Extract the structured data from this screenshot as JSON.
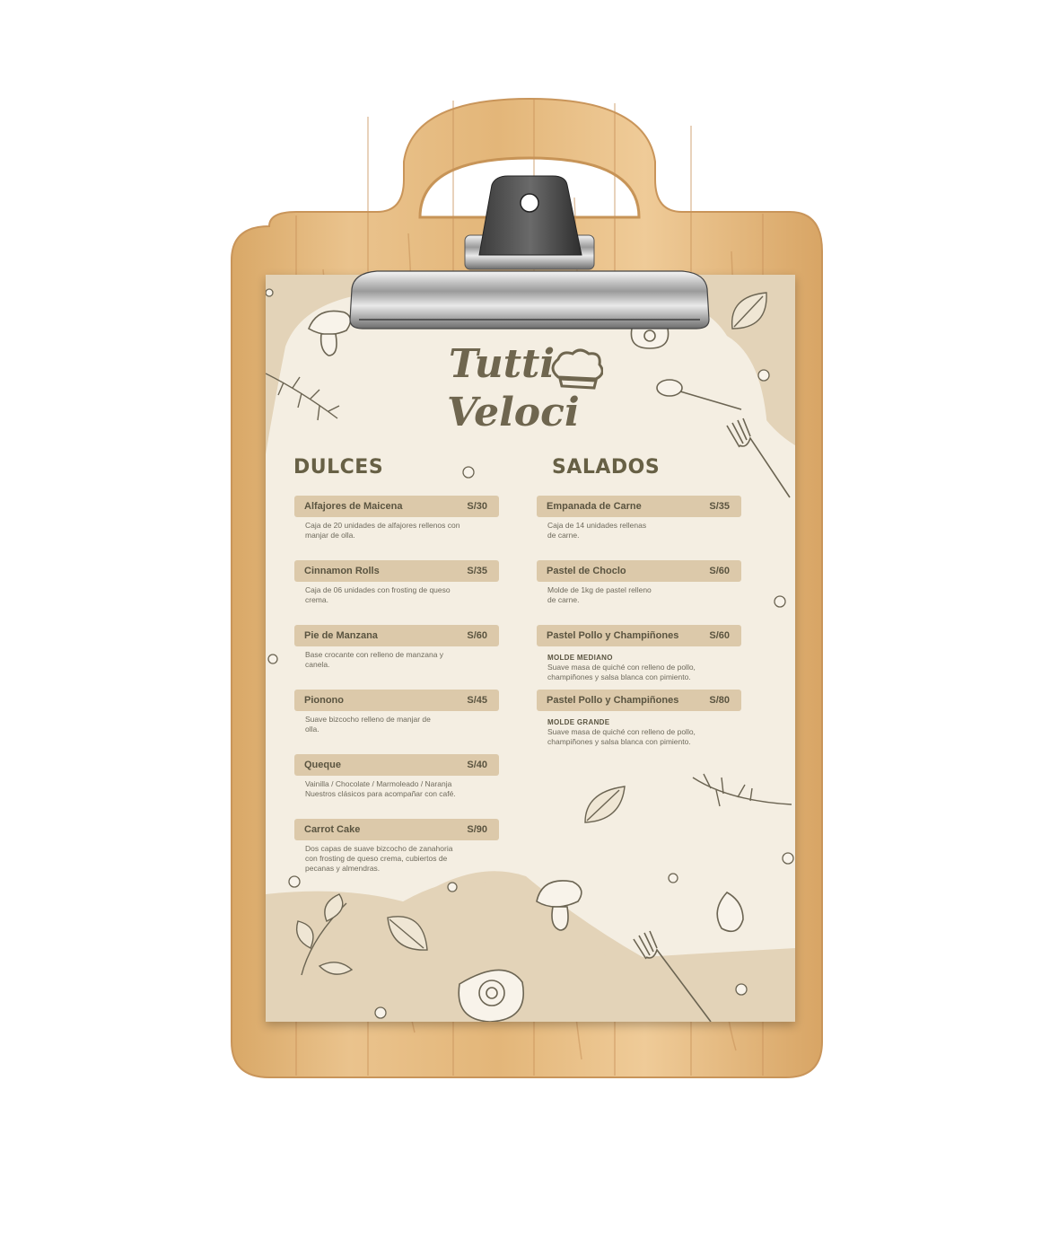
{
  "brand": {
    "line1": "Tutti",
    "line2": "Veloci"
  },
  "dulces": {
    "title": "DULCES",
    "items": [
      {
        "name": "Alfajores de Maicena",
        "price": "S/30",
        "desc": "Caja de 20 unidades de alfajores rellenos con\nmanjar de olla."
      },
      {
        "name": "Cinnamon Rolls",
        "price": "S/35",
        "desc": "Caja de 06 unidades con frosting de queso\ncrema."
      },
      {
        "name": "Pie de Manzana",
        "price": "S/60",
        "desc": "Base crocante con relleno de manzana y\ncanela."
      },
      {
        "name": "Pionono",
        "price": "S/45",
        "desc": "Suave bizcocho relleno de manjar de\nolla."
      },
      {
        "name": "Queque",
        "price": "S/40",
        "desc": "Vainilla / Chocolate / Marmoleado / Naranja\nNuestros clásicos para acompañar con café."
      },
      {
        "name": "Carrot Cake",
        "price": "S/90",
        "desc": "Dos capas de suave bizcocho de zanahoria\ncon frosting de queso crema, cubiertos de\npecanas y almendras."
      }
    ]
  },
  "salados": {
    "title": "SALADOS",
    "items": [
      {
        "name": "Empanada de Carne",
        "price": "S/35",
        "desc": "Caja de 14 unidades rellenas\nde carne."
      },
      {
        "name": "Pastel de Choclo",
        "price": "S/60",
        "desc": "Molde de 1kg de pastel relleno\nde carne."
      },
      {
        "name": "Pastel Pollo y Champiñones",
        "price": "S/60",
        "sub": "MOLDE MEDIANO",
        "desc": "Suave masa de quiché con relleno de pollo,\nchampiñones y salsa blanca con pimiento."
      },
      {
        "name": "Pastel Pollo y Champiñones",
        "price": "S/80",
        "sub": "MOLDE GRANDE",
        "desc": "Suave masa de quiché con relleno de pollo,\nchampiñones y salsa blanca con pimiento."
      }
    ]
  },
  "colors": {
    "paper": "#f4eee2",
    "blob": "#e3d3b8",
    "bar": "#dcc9aa",
    "text": "#676045",
    "wood": "#e0b47a"
  },
  "icons": [
    "mushroom-icon",
    "leaf-icon",
    "spoon-icon",
    "fork-icon",
    "herb-icon",
    "pepper-icon",
    "garlic-icon",
    "clip-icon"
  ]
}
